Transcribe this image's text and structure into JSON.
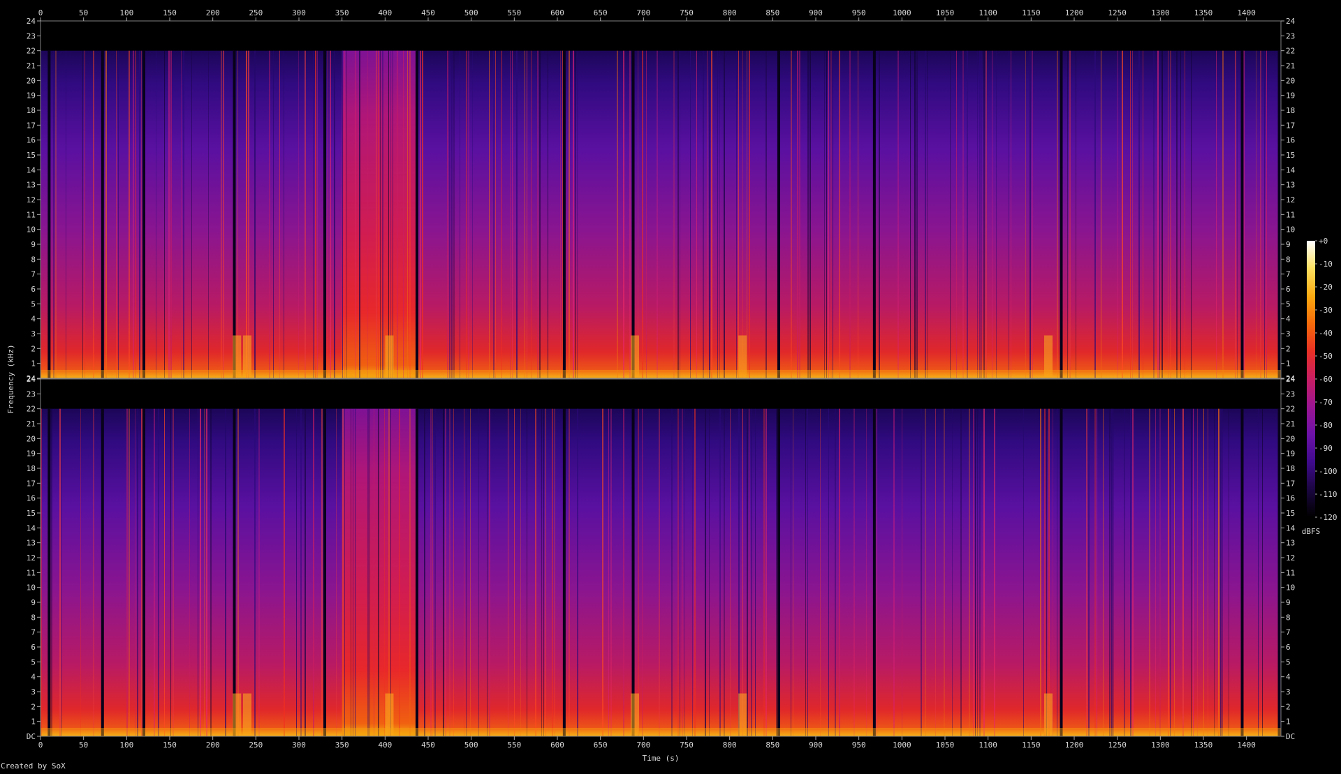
{
  "chart_data": {
    "type": "heatmap",
    "title": "",
    "xlabel": "Time (s)",
    "ylabel": "Frequency (kHz)",
    "xlim": [
      0,
      1440
    ],
    "ylim": [
      0,
      24
    ],
    "x_ticks": [
      0,
      50,
      100,
      150,
      200,
      250,
      300,
      350,
      400,
      450,
      500,
      550,
      600,
      650,
      700,
      750,
      800,
      850,
      900,
      950,
      1000,
      1050,
      1100,
      1150,
      1200,
      1250,
      1300,
      1350,
      1400
    ],
    "y_ticks": [
      "DC",
      "1",
      "2",
      "3",
      "4",
      "5",
      "6",
      "7",
      "8",
      "9",
      "10",
      "11",
      "12",
      "13",
      "14",
      "15",
      "16",
      "17",
      "18",
      "19",
      "20",
      "21",
      "22",
      "23",
      "24"
    ],
    "channels": 2,
    "bandwidth_khz": 22,
    "colorbar": {
      "label": "dBFS",
      "range": [
        -120,
        0
      ],
      "ticks": [
        "+0",
        "-10",
        "-20",
        "-30",
        "-40",
        "-50",
        "-60",
        "-70",
        "-80",
        "-90",
        "-100",
        "-110",
        "-120"
      ],
      "colors": [
        "#000000",
        "#1a0640",
        "#3f0a8c",
        "#6d12a8",
        "#9c1592",
        "#c81e63",
        "#e83025",
        "#f56a0a",
        "#fbaa10",
        "#fde060",
        "#ffffff"
      ]
    },
    "quiet_gaps_s": [
      10,
      72,
      120,
      225,
      330,
      437,
      608,
      688,
      857,
      968,
      1185,
      1395,
      1438
    ],
    "tall_segment_s": [
      350,
      437
    ],
    "bright_bursts_s": [
      228,
      240,
      405,
      690,
      815,
      1170
    ]
  },
  "credit": "Created by SoX"
}
